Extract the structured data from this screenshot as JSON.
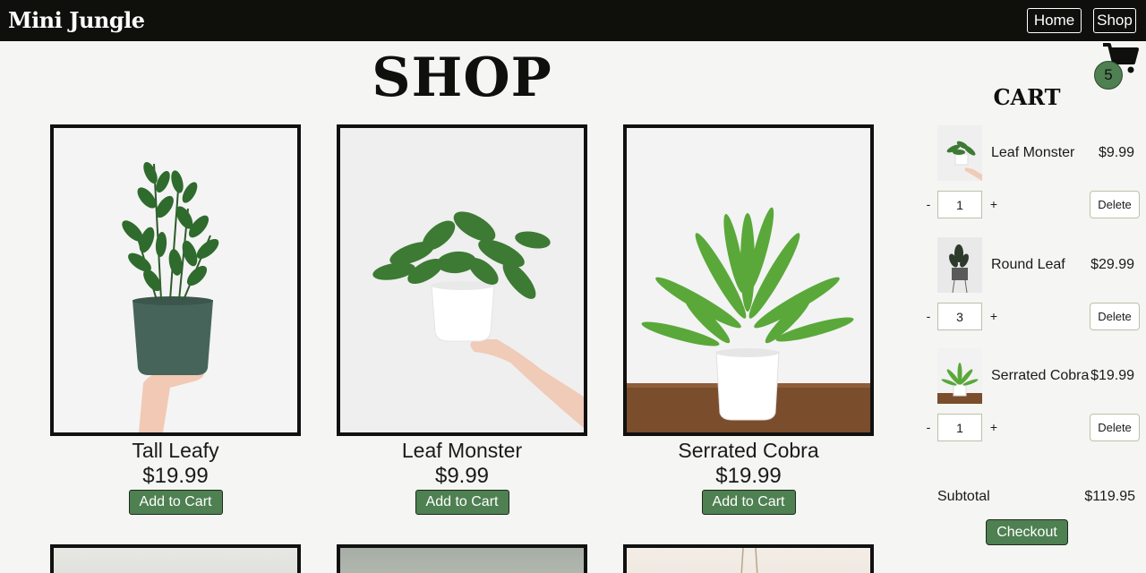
{
  "header": {
    "brand": "Mini Jungle",
    "nav": [
      {
        "label": "Home"
      },
      {
        "label": "Shop"
      }
    ]
  },
  "shop": {
    "title": "SHOP",
    "products": [
      {
        "name": "Tall Leafy",
        "price": "$19.99",
        "button": "Add to Cart"
      },
      {
        "name": "Leaf Monster",
        "price": "$9.99",
        "button": "Add to Cart"
      },
      {
        "name": "Serrated Cobra",
        "price": "$19.99",
        "button": "Add to Cart"
      }
    ]
  },
  "cart": {
    "icon": "shopping-cart-icon",
    "badge_count": "5",
    "title": "CART",
    "items": [
      {
        "name": "Leaf Monster",
        "price": "$9.99",
        "qty": "1",
        "minus": "-",
        "plus": "+",
        "delete": "Delete"
      },
      {
        "name": "Round Leaf",
        "price": "$29.99",
        "qty": "3",
        "minus": "-",
        "plus": "+",
        "delete": "Delete"
      },
      {
        "name": "Serrated Cobra",
        "price": "$19.99",
        "qty": "1",
        "minus": "-",
        "plus": "+",
        "delete": "Delete"
      }
    ],
    "subtotal_label": "Subtotal",
    "subtotal_value": "$119.95",
    "checkout": "Checkout"
  },
  "colors": {
    "header_bg": "#0f0f0c",
    "accent_green": "#4e8051",
    "page_bg": "#f5f5f3"
  }
}
